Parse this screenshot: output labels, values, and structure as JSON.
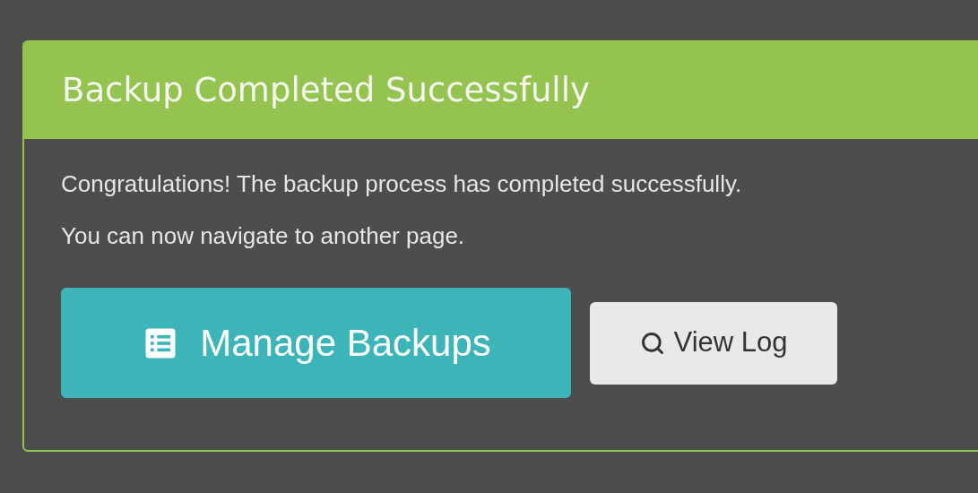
{
  "panel": {
    "title": "Backup Completed Successfully",
    "messages": [
      "Congratulations! The backup process has completed successfully.",
      "You can now navigate to another page."
    ],
    "buttons": [
      {
        "kind": "primary",
        "label": "Manage Backups"
      },
      {
        "kind": "secondary",
        "label": "View Log"
      }
    ]
  }
}
